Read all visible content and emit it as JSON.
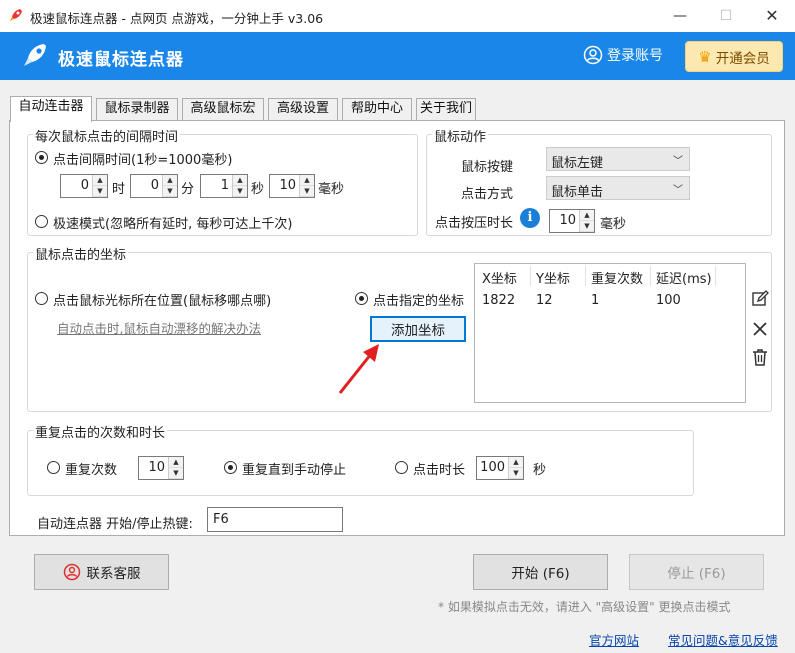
{
  "window": {
    "title": "极速鼠标连点器 - 点网页 点游戏，一分钟上手 v3.06"
  },
  "header": {
    "brand": "极速鼠标连点器",
    "login": "登录账号",
    "vip": "开通会员"
  },
  "tabs": [
    {
      "label": "自动连击器",
      "active": true
    },
    {
      "label": "鼠标录制器"
    },
    {
      "label": "高级鼠标宏"
    },
    {
      "label": "高级设置"
    },
    {
      "label": "帮助中心"
    },
    {
      "label": "关于我们"
    }
  ],
  "interval": {
    "group_label": "每次鼠标点击的间隔时间",
    "option1": "点击间隔时间(1秒=1000毫秒)",
    "hours": "0",
    "hours_unit": "时",
    "minutes": "0",
    "minutes_unit": "分",
    "seconds": "1",
    "seconds_unit": "秒",
    "ms": "10",
    "ms_unit": "毫秒",
    "option2": "极速模式(忽略所有延时, 每秒可达上千次)"
  },
  "action": {
    "group_label": "鼠标动作",
    "button_label": "鼠标按键",
    "button_value": "鼠标左键",
    "method_label": "点击方式",
    "method_value": "鼠标单击",
    "press_label": "点击按压时长",
    "press_value": "10",
    "press_unit": "毫秒"
  },
  "coords": {
    "group_label": "鼠标点击的坐标",
    "option_cursor": "点击鼠标光标所在位置(鼠标移哪点哪)",
    "drift_link": "自动点击时,鼠标自动漂移的解决办法",
    "option_specified": "点击指定的坐标",
    "add_button": "添加坐标",
    "columns": [
      "X坐标",
      "Y坐标",
      "重复次数",
      "延迟(ms)"
    ],
    "rows": [
      [
        "1822",
        "12",
        "1",
        "100"
      ]
    ]
  },
  "repeat": {
    "group_label": "重复点击的次数和时长",
    "opt_count": "重复次数",
    "count_value": "10",
    "opt_until_stop": "重复直到手动停止",
    "opt_duration": "点击时长",
    "duration_value": "100",
    "duration_unit": "秒"
  },
  "hotkey": {
    "label": "自动连点器 开始/停止热键:",
    "value": "F6"
  },
  "footer": {
    "support": "联系客服",
    "start": "开始 (F6)",
    "stop": "停止 (F6)",
    "note": "* 如果模拟点击无效，请进入 \"高级设置\" 更换点击模式",
    "link_site": "官方网站",
    "link_faq": "常见问题&意见反馈"
  },
  "colors": {
    "header_blue": "#1a86e8",
    "vip_bg": "#fde9b0",
    "arrow_red": "#e02020"
  }
}
